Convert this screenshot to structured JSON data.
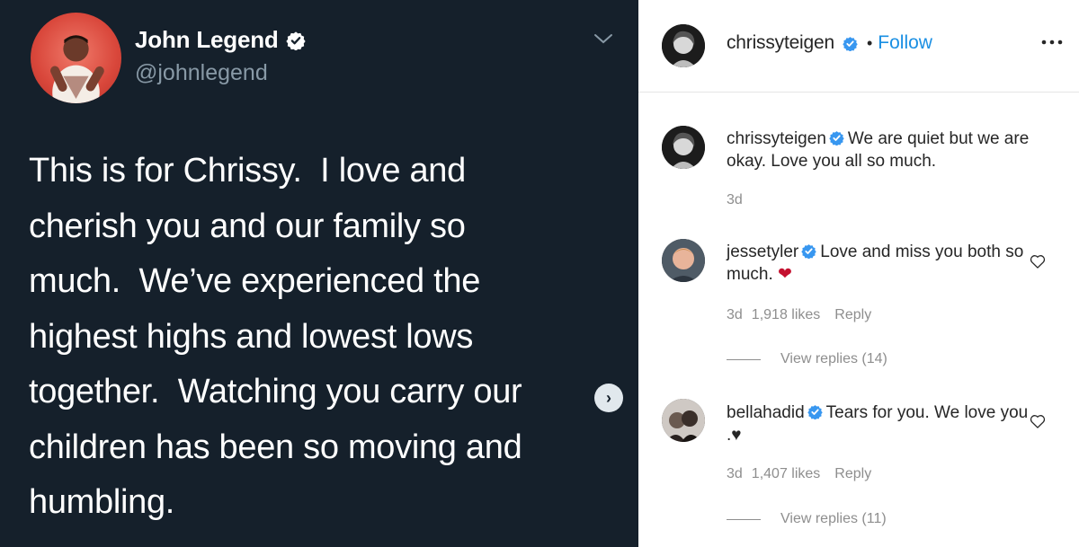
{
  "tweet": {
    "display_name": "John Legend",
    "handle": "@johnlegend",
    "text": "This is for Chrissy.  I love and\ncherish you and our family so\nmuch.  We’ve experienced the\nhighest highs and lowest lows\ntogether.  Watching you carry our\nchildren has been so moving and\nhumbling.",
    "next_glyph": "›",
    "colors": {
      "background": "#15202b",
      "handle": "#8899a6",
      "text": "#ffffff"
    }
  },
  "instagram": {
    "header": {
      "username": "chrissyteigen",
      "separator": "•",
      "follow_label": "Follow",
      "more_icon": "more-horizontal-icon"
    },
    "comments": [
      {
        "username": "chrissyteigen",
        "text": "We are quiet but we are okay. Love you all so much.",
        "time": "3d",
        "likes": "",
        "reply_label": "",
        "view_replies": ""
      },
      {
        "username": "jessetyler",
        "text": "Love and miss you both so much.",
        "emoji": "❤",
        "time": "3d",
        "likes": "1,918 likes",
        "reply_label": "Reply",
        "view_replies": "View replies (14)"
      },
      {
        "username": "bellahadid",
        "text": "Tears for you. We love you .",
        "emoji": "♥",
        "time": "3d",
        "likes": "1,407 likes",
        "reply_label": "Reply",
        "view_replies": "View replies (11)"
      }
    ],
    "colors": {
      "follow": "#1a8fe3",
      "meta": "#8e8e8e",
      "verified": "#3897f0",
      "heart": "#c4112f"
    }
  }
}
